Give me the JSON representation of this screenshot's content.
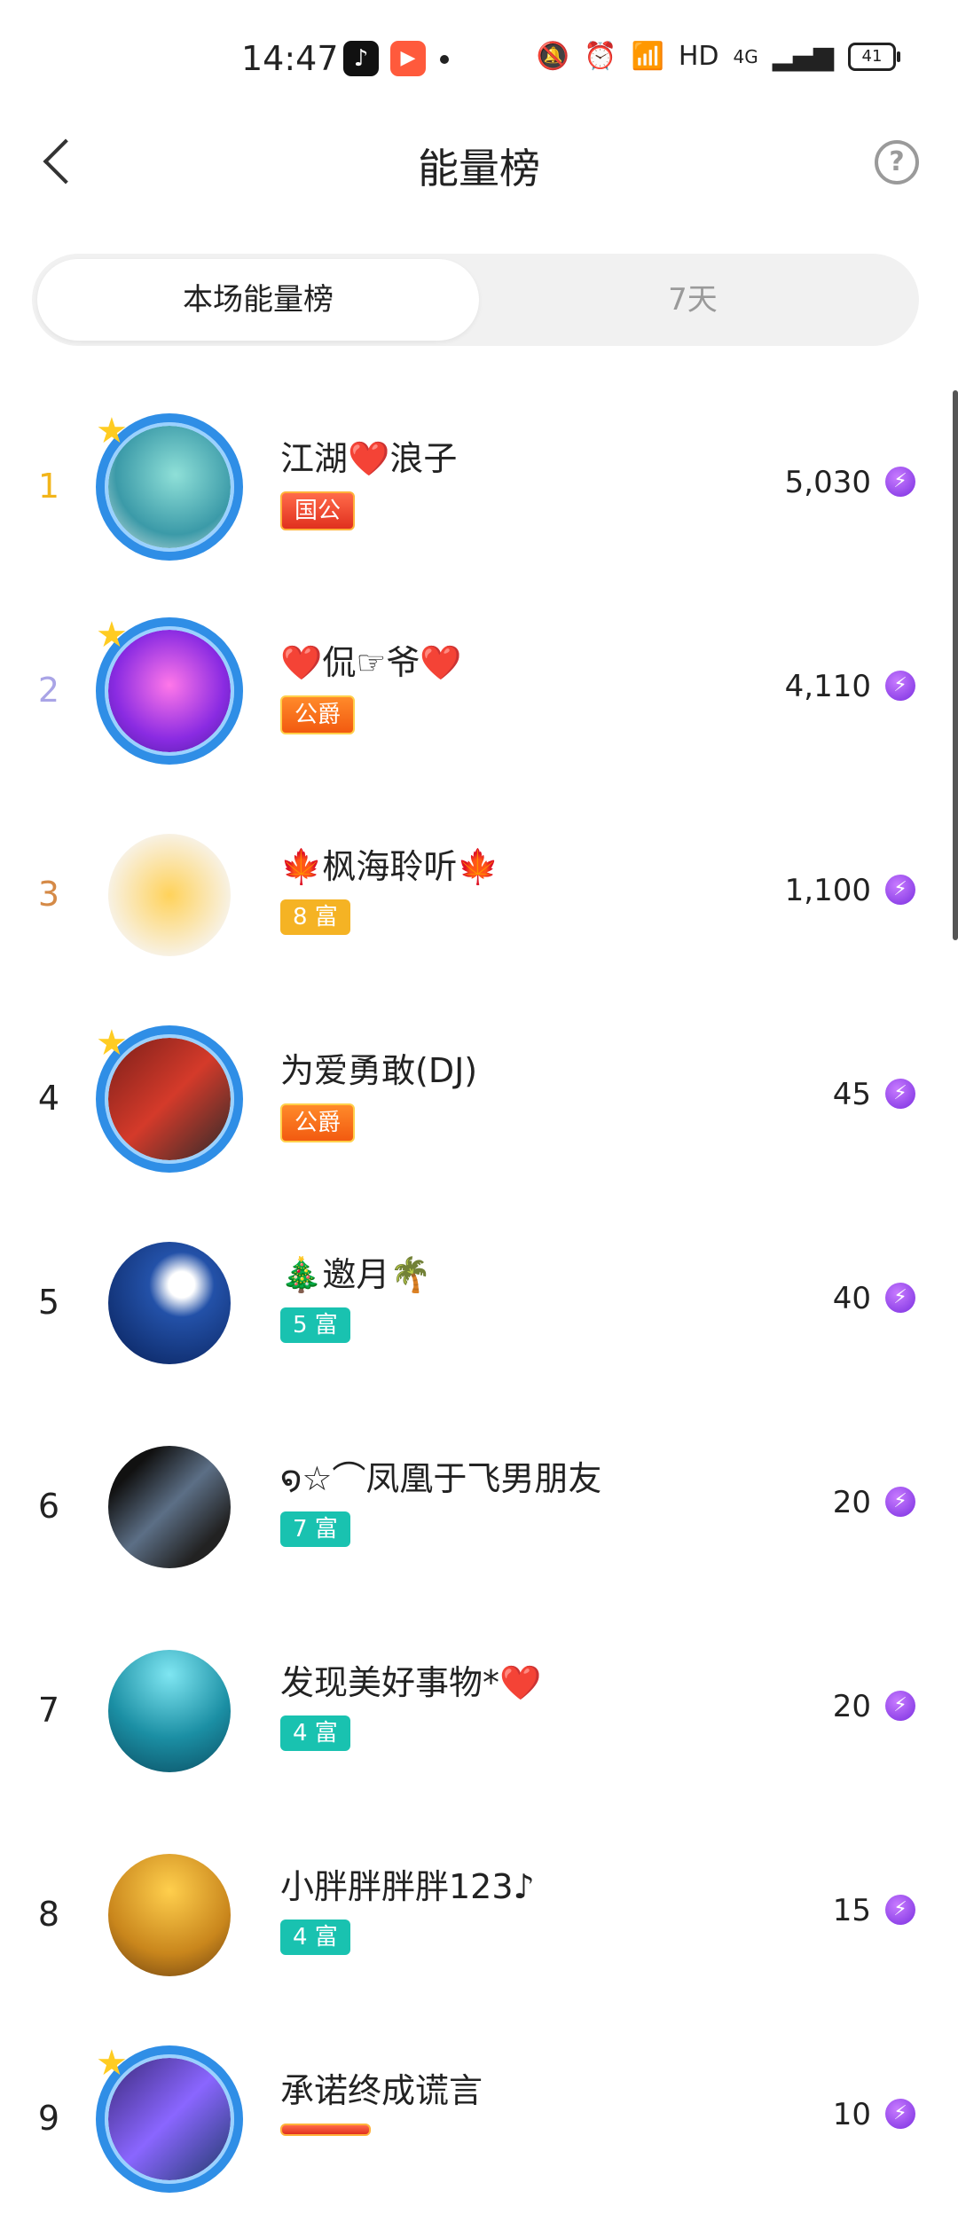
{
  "status": {
    "time": "14:47",
    "icons": [
      "tiktok-icon",
      "kuaishou-icon",
      "mute-icon",
      "alarm-icon",
      "wifi-icon",
      "signal-icon"
    ],
    "hd": "HD",
    "network": "4G",
    "battery": "41"
  },
  "header": {
    "title": "能量榜",
    "back_icon": "chevron-left-icon",
    "help_icon": "question-circle-icon"
  },
  "tabs": [
    {
      "label": "本场能量榜",
      "active": true
    },
    {
      "label": "7天",
      "active": false
    }
  ],
  "list": [
    {
      "rank": "1",
      "name": "江湖❤️浪子",
      "badge": "国公",
      "badge_style": "red",
      "score": "5,030",
      "frame": true
    },
    {
      "rank": "2",
      "name": "❤️侃☞爷❤️",
      "badge": "公爵",
      "badge_style": "orange",
      "score": "4,110",
      "frame": true
    },
    {
      "rank": "3",
      "name": "🍁枫海聆听🍁",
      "badge": "8 富",
      "badge_style": "gold",
      "score": "1,100",
      "frame": false
    },
    {
      "rank": "4",
      "name": "为爱勇敢(DJ)",
      "badge": "公爵",
      "badge_style": "orange",
      "score": "45",
      "frame": true
    },
    {
      "rank": "5",
      "name": "🎄邀月🌴",
      "badge": "5 富",
      "badge_style": "teal",
      "score": "40",
      "frame": false
    },
    {
      "rank": "6",
      "name": "໑☆⌒凤凰于飞男朋友",
      "badge": "7 富",
      "badge_style": "teal",
      "score": "20",
      "frame": false
    },
    {
      "rank": "7",
      "name": "发现美好事物*❤️",
      "badge": "4 富",
      "badge_style": "teal",
      "score": "20",
      "frame": false
    },
    {
      "rank": "8",
      "name": "小胖胖胖胖123♪",
      "badge": "4 富",
      "badge_style": "teal",
      "score": "15",
      "frame": false
    },
    {
      "rank": "9",
      "name": "承诺终成谎言",
      "badge": "",
      "badge_style": "red",
      "score": "10",
      "frame": true
    }
  ],
  "colors": {
    "gold_rank": "#f2b51a",
    "silver_rank": "#a9a4e6",
    "bronze_rank": "#d58a47",
    "energy_icon": "#8a3cf0"
  }
}
